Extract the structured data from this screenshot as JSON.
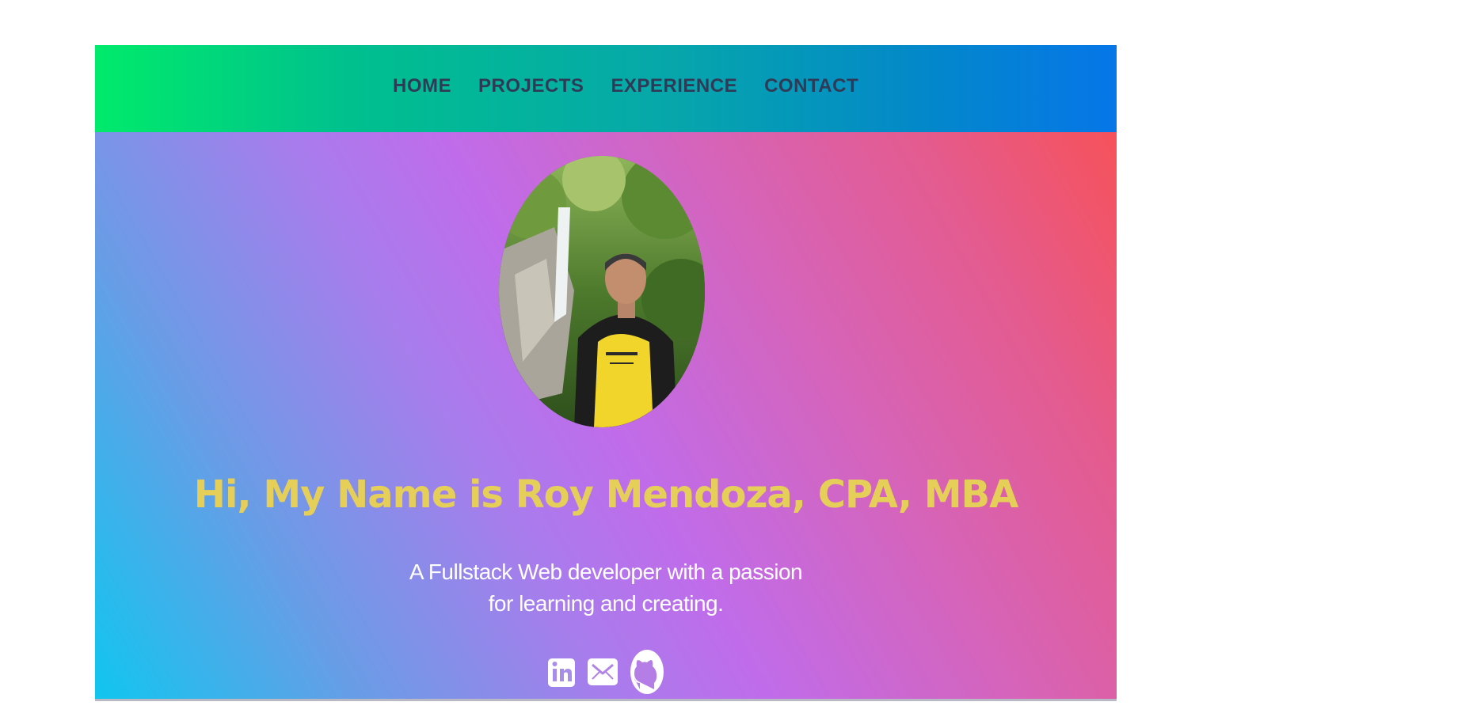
{
  "nav": {
    "items": [
      {
        "label": "HOME"
      },
      {
        "label": "PROJECTS"
      },
      {
        "label": "EXPERIENCE"
      },
      {
        "label": "CONTACT"
      }
    ]
  },
  "hero": {
    "headline": "Hi, My Name is Roy Mendoza, CPA, MBA",
    "tagline": "A Fullstack Web developer with a passion for learning and creating."
  },
  "socials": [
    {
      "icon": "linkedin-icon"
    },
    {
      "icon": "email-icon"
    },
    {
      "icon": "github-icon"
    }
  ],
  "colors": {
    "nav_text": "#2f3b56",
    "headline": "#e6cf58",
    "tagline": "#ffffff"
  }
}
